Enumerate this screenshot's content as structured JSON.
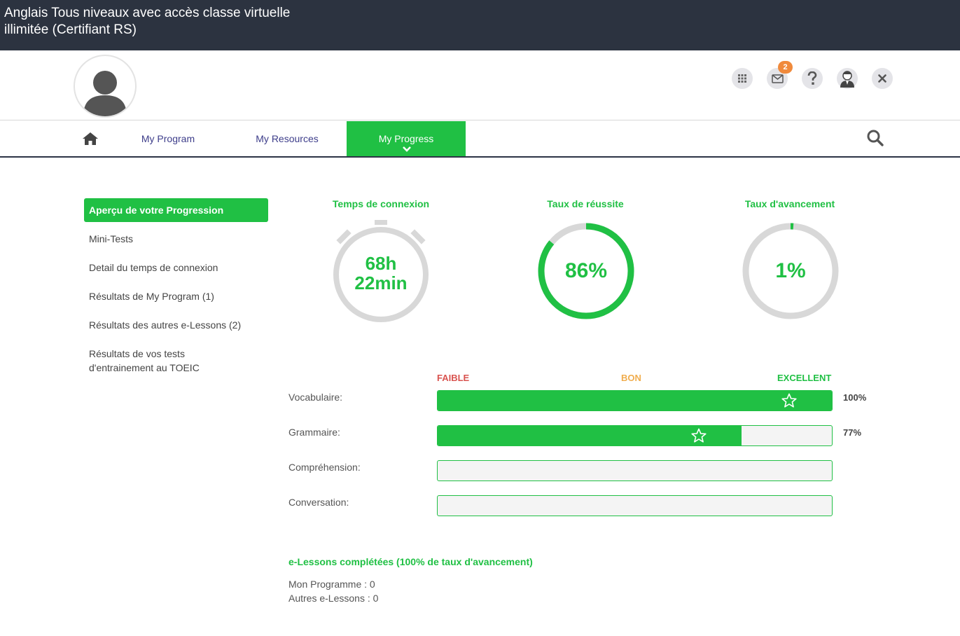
{
  "window": {
    "title": "Anglais Tous niveaux avec accès classe virtuelle illimitée (Certifiant RS)"
  },
  "header": {
    "icons": [
      "apps-grid-icon",
      "mail-icon",
      "help-icon",
      "user-profile-icon",
      "close-icon"
    ],
    "mail_badge": "2"
  },
  "nav": {
    "tabs": [
      {
        "label": "My Program"
      },
      {
        "label": "My Resources"
      },
      {
        "label": "My Progress"
      }
    ],
    "active_tab": "My Progress"
  },
  "sidebar": {
    "items": [
      {
        "label": "Aperçu de votre Progression"
      },
      {
        "label": "Mini-Tests"
      },
      {
        "label": "Detail du temps de connexion"
      },
      {
        "label": "Résultats de My Program (1)"
      },
      {
        "label": "Résultats des autres e-Lessons (2)"
      },
      {
        "label": "Résultats de vos tests d'entrainement au TOEIC"
      }
    ]
  },
  "stats": {
    "connexion": {
      "title": "Temps de connexion",
      "line1": "68h",
      "line2": "22min"
    },
    "reussite": {
      "title": "Taux de réussite",
      "value_text": "86%",
      "value": 86
    },
    "avancement": {
      "title": "Taux d'avancement",
      "value_text": "1%",
      "value": 1
    }
  },
  "scale": {
    "low": "FAIBLE",
    "mid": "BON",
    "high": "EXCELLENT"
  },
  "skills": [
    {
      "label": "Vocabulaire:",
      "value": 100,
      "pct_text": "100%"
    },
    {
      "label": "Grammaire:",
      "value": 77,
      "pct_text": "77%"
    },
    {
      "label": "Compréhension:",
      "value": 0,
      "pct_text": ""
    },
    {
      "label": "Conversation:",
      "value": 0,
      "pct_text": ""
    }
  ],
  "lessons": {
    "title": "e-Lessons complétées (100% de taux d'avancement)",
    "programme": "Mon Programme : 0",
    "autres": "Autres e-Lessons : 0"
  },
  "colors": {
    "accent": "#20c044",
    "topbar": "#2c3340",
    "badge": "#f08a3c",
    "faible": "#d9534f",
    "bon": "#f0ad4e",
    "excellent": "#20c044",
    "ring_track": "#d8d8d8"
  }
}
